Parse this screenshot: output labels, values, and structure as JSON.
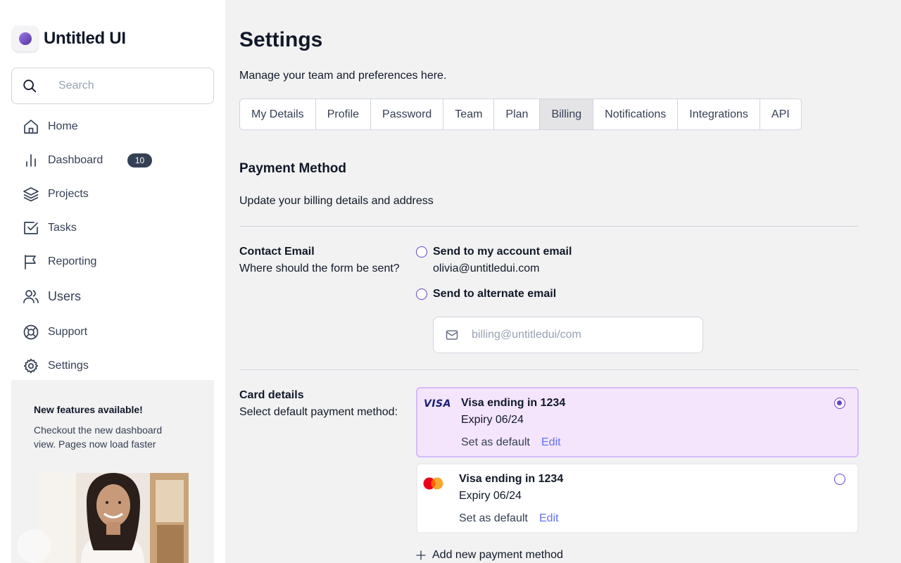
{
  "brand": {
    "name": "Untitled UI"
  },
  "search": {
    "placeholder": "Search"
  },
  "sidebar": {
    "items": [
      {
        "label": "Home",
        "icon": "home-icon"
      },
      {
        "label": "Dashboard",
        "icon": "bar-chart-icon",
        "badge": "10"
      },
      {
        "label": "Projects",
        "icon": "layers-icon"
      },
      {
        "label": "Tasks",
        "icon": "check-square-icon"
      },
      {
        "label": "Reporting",
        "icon": "flag-icon"
      },
      {
        "label": "Users",
        "icon": "users-icon"
      },
      {
        "label": "Support",
        "icon": "life-buoy-icon"
      },
      {
        "label": "Settings",
        "icon": "gear-icon"
      }
    ],
    "promo": {
      "title": "New features available!",
      "text": "Checkout the new dashboard view. Pages now load faster"
    }
  },
  "page": {
    "title": "Settings",
    "subtitle": "Manage your team and preferences here."
  },
  "tabs": [
    {
      "label": "My Details",
      "active": false
    },
    {
      "label": "Profile",
      "active": false
    },
    {
      "label": "Password",
      "active": false
    },
    {
      "label": "Team",
      "active": false
    },
    {
      "label": "Plan",
      "active": false
    },
    {
      "label": "Billing",
      "active": true
    },
    {
      "label": "Notifications",
      "active": false
    },
    {
      "label": "Integrations",
      "active": false
    },
    {
      "label": "API",
      "active": false
    }
  ],
  "payment": {
    "title": "Payment Method",
    "subtitle": "Update your billing details and address"
  },
  "contact": {
    "label": "Contact Email",
    "help": "Where should the form be sent?",
    "option_account_label": "Send to my account email",
    "account_email": "olivia@untitledui.com",
    "option_alternate_label": "Send to alternate email",
    "alternate_placeholder": "billing@untitledui/com"
  },
  "cards": {
    "label": "Card details",
    "help": "Select default payment method:",
    "items": [
      {
        "brand": "VISA",
        "title": "Visa ending in 1234",
        "expiry": "Expiry 06/24",
        "set_default": "Set as default",
        "edit": "Edit",
        "selected": true
      },
      {
        "brand": "mastercard",
        "title": "Visa ending in 1234",
        "expiry": "Expiry 06/24",
        "set_default": "Set as default",
        "edit": "Edit",
        "selected": false
      }
    ],
    "add_label": "Add new payment method"
  },
  "colors": {
    "accent": "#6941c6",
    "selected_card_bg": "#f4e5fc",
    "link": "#6172f3",
    "badge_bg": "#344054"
  }
}
